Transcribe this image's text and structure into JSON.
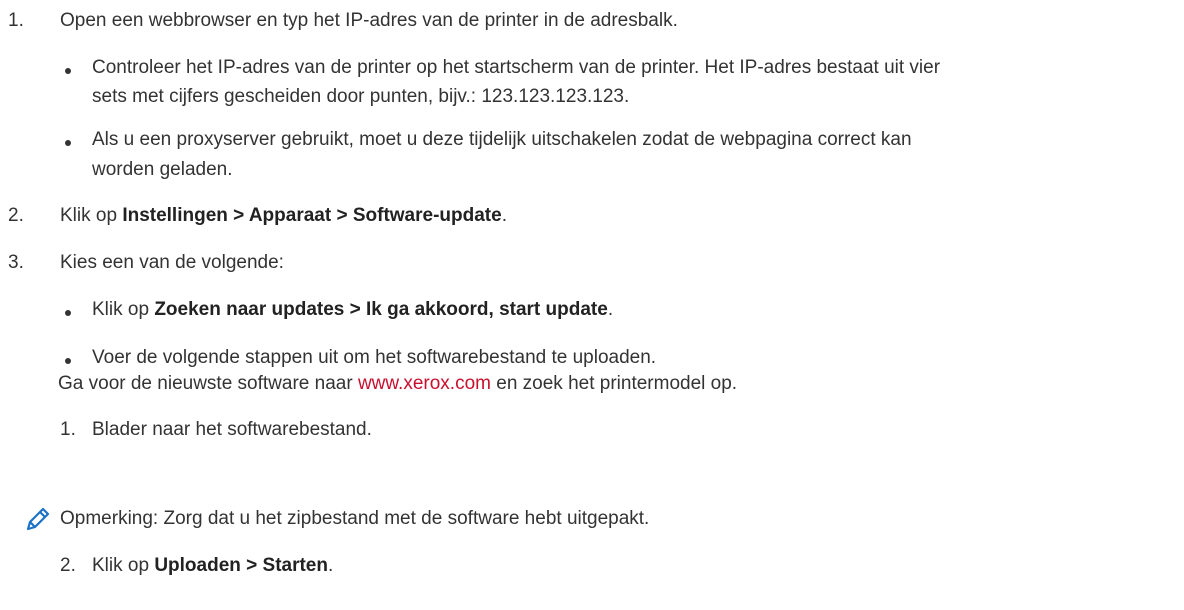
{
  "steps": [
    {
      "number": "1.",
      "text": "Open een webbrowser en typ het IP-adres van de printer in de adresbalk.",
      "bullets": [
        {
          "line1": "Controleer het IP-adres van de printer op het startscherm van de printer. Het IP-adres bestaat uit vier",
          "line2": "sets met cijfers gescheiden door punten, bijv.: 123.123.123.123."
        },
        {
          "line1": "Als u een proxyserver gebruikt, moet u deze tijdelijk uitschakelen zodat de webpagina correct kan",
          "line2": "worden geladen."
        }
      ]
    },
    {
      "number": "2.",
      "prefix": "Klik op ",
      "bold": "Instellingen > Apparaat > Software-update",
      "suffix": "."
    },
    {
      "number": "3.",
      "text": "Kies een van de volgende:",
      "bullets": [
        {
          "prefix": "Klik op ",
          "bold": "Zoeken naar updates > Ik ga akkoord, start update",
          "suffix": "."
        },
        {
          "line1": "Voer de volgende stappen uit om het softwarebestand te uploaden.",
          "line2_prefix": "Ga voor de nieuwste software naar ",
          "link": "www.xerox.com",
          "line2_suffix": " en zoek het printermodel op."
        }
      ],
      "substeps": [
        {
          "number": "1.",
          "text": "Blader naar het softwarebestand."
        },
        {
          "number": "2.",
          "prefix": "Klik op ",
          "bold": "Uploaden > Starten",
          "suffix": "."
        }
      ],
      "note": "Opmerking: Zorg dat u het zipbestand met de software hebt uitgepakt."
    }
  ],
  "icons": {
    "note": "pencil-icon"
  },
  "colors": {
    "text": "#333333",
    "link": "#c8102e",
    "icon": "#1b72c7"
  }
}
